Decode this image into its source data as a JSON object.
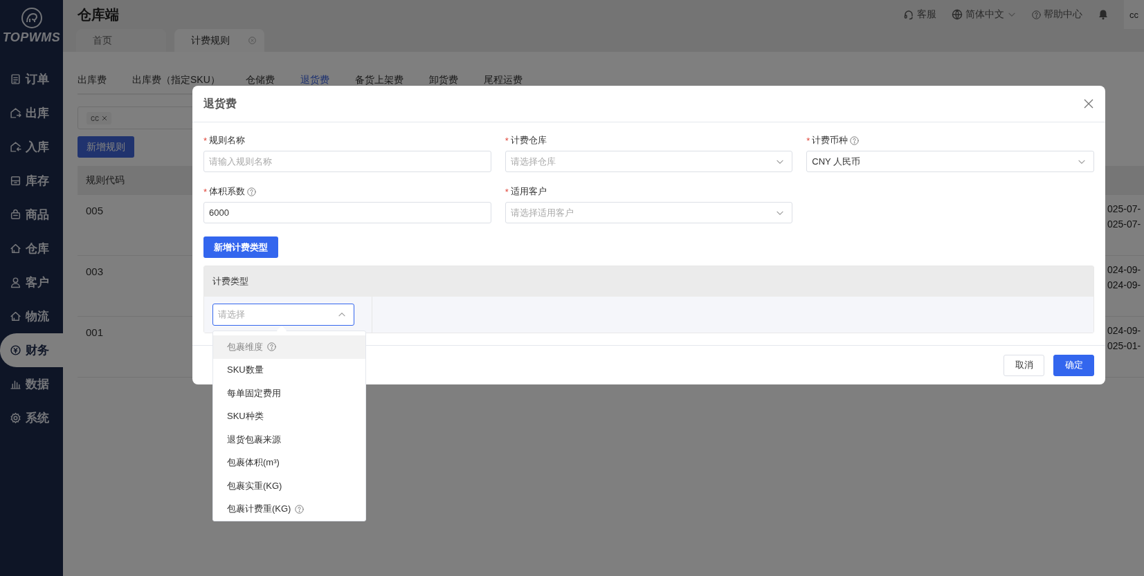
{
  "app": {
    "logo": "TOPWMS",
    "title": "仓库端"
  },
  "sidebar": {
    "items": [
      {
        "label": "订单",
        "selected": false
      },
      {
        "label": "出库",
        "selected": false
      },
      {
        "label": "入库",
        "selected": false
      },
      {
        "label": "库存",
        "selected": false
      },
      {
        "label": "商品",
        "selected": false
      },
      {
        "label": "仓库",
        "selected": false
      },
      {
        "label": "客户",
        "selected": false
      },
      {
        "label": "物流",
        "selected": false
      },
      {
        "label": "财务",
        "selected": true
      },
      {
        "label": "数据",
        "selected": false
      },
      {
        "label": "系统",
        "selected": false
      }
    ]
  },
  "topbar": {
    "service": "客服",
    "language": "简体中文",
    "help": "帮助中心",
    "user": "cc"
  },
  "page_tabs": [
    {
      "label": "首页",
      "selected": false,
      "closable": false
    },
    {
      "label": "计费规则",
      "selected": true,
      "closable": true
    }
  ],
  "fee_tabs": [
    {
      "label": "出库费",
      "selected": false
    },
    {
      "label": "出库费（指定SKU）",
      "selected": false
    },
    {
      "label": "仓储费",
      "selected": false
    },
    {
      "label": "退货费",
      "selected": true
    },
    {
      "label": "备货上架费",
      "selected": false
    },
    {
      "label": "卸货费",
      "selected": false
    },
    {
      "label": "尾程运费",
      "selected": false
    }
  ],
  "filter": {
    "tags": [
      "cc"
    ]
  },
  "add_rule_button": "新增规则",
  "table": {
    "columns": [
      "规则代码"
    ],
    "rows": [
      {
        "code": "005",
        "dates": [
          "025-07-",
          "025-07-"
        ]
      },
      {
        "code": "003",
        "dates": [
          "024-09-",
          "024-09-"
        ]
      },
      {
        "code": "001",
        "dates": [
          "024-09-",
          "025-01-"
        ]
      }
    ]
  },
  "dialog": {
    "title": "退货费",
    "fields": [
      {
        "label": "规则名称",
        "required_mark": "*",
        "help": false,
        "kind": "input",
        "placeholder": "请输入规则名称"
      },
      {
        "label": "计费仓库",
        "required_mark": "*",
        "help": false,
        "kind": "select",
        "placeholder": "请选择仓库"
      },
      {
        "label": "计费币种",
        "required_mark": "*",
        "help": true,
        "kind": "select",
        "value": "CNY 人民币"
      },
      {
        "label": "体积系数",
        "required_mark": "*",
        "help": true,
        "kind": "input",
        "value": "6000"
      },
      {
        "label": "适用客户",
        "required_mark": "*",
        "help": false,
        "kind": "select",
        "placeholder": "请选择适用客户"
      }
    ],
    "add_type_button": "新增计费类型",
    "type_table": {
      "column": "计费类型",
      "select": {
        "placeholder": "请选择",
        "expanded": true
      }
    },
    "dropdown": [
      {
        "label": "包裹维度",
        "highlighted": true,
        "help": true
      },
      {
        "label": "SKU数量",
        "highlighted": false,
        "help": false
      },
      {
        "label": "每单固定费用",
        "highlighted": false,
        "help": false
      },
      {
        "label": "SKU种类",
        "highlighted": false,
        "help": false
      },
      {
        "label": "退货包裹来源",
        "highlighted": false,
        "help": false
      },
      {
        "label": "包裹体积(m³)",
        "highlighted": false,
        "help": false
      },
      {
        "label": "包裹实重(KG)",
        "highlighted": false,
        "help": false
      },
      {
        "label": "包裹计费重(KG)",
        "highlighted": false,
        "help": true
      }
    ],
    "buttons": [
      {
        "label": "取消",
        "kind": "default"
      },
      {
        "label": "确定",
        "kind": "primary"
      }
    ]
  }
}
